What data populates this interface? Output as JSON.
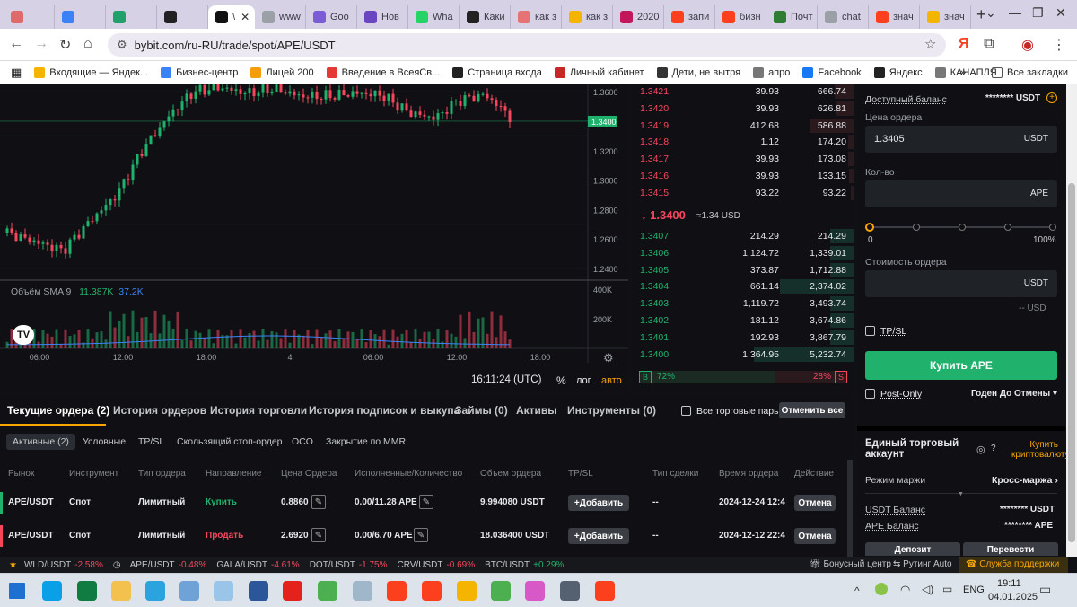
{
  "browser": {
    "tabs": [
      {
        "label": "",
        "color": "#e06a6a"
      },
      {
        "label": "",
        "color": "#3b82f6"
      },
      {
        "label": "",
        "color": "#22a06b"
      },
      {
        "label": "",
        "color": "#222222"
      },
      {
        "label": "\\",
        "color": "#111111",
        "active": true
      },
      {
        "label": "www",
        "color": "#9aa0a6"
      },
      {
        "label": "Goo",
        "color": "#7c5cd6"
      },
      {
        "label": "Нов",
        "color": "#6b46c1"
      },
      {
        "label": "Wha",
        "color": "#25d366"
      },
      {
        "label": "Каки",
        "color": "#222222"
      },
      {
        "label": "как з",
        "color": "#e57373"
      },
      {
        "label": "как з",
        "color": "#f4b400"
      },
      {
        "label": "2020",
        "color": "#c2185b"
      },
      {
        "label": "запи",
        "color": "#fc3f1d"
      },
      {
        "label": "бизн",
        "color": "#fc3f1d"
      },
      {
        "label": "Почт",
        "color": "#2e7d32"
      },
      {
        "label": "chat",
        "color": "#9aa0a6"
      },
      {
        "label": "знач",
        "color": "#fc3f1d"
      },
      {
        "label": "знач",
        "color": "#f4b400"
      }
    ],
    "url": "bybit.com/ru-RU/trade/spot/APE/USDT",
    "bookmarks": [
      {
        "label": "Входящие — Яндек...",
        "color": "#f4b400"
      },
      {
        "label": "Бизнес-центр",
        "color": "#3b82f6"
      },
      {
        "label": "Лицей 200",
        "color": "#f59e0b"
      },
      {
        "label": "Введение в ВсеяСв...",
        "color": "#e53935"
      },
      {
        "label": "Страница входа",
        "color": "#222222"
      },
      {
        "label": "Личный кабинет",
        "color": "#c62828"
      },
      {
        "label": "Дети, не вытря",
        "color": "#333333"
      },
      {
        "label": "апро",
        "color": "#777777"
      },
      {
        "label": "Facebook",
        "color": "#1877f2"
      },
      {
        "label": "Яндекс",
        "color": "#222222"
      },
      {
        "label": "КАНАПЛЯ",
        "color": "#777777"
      }
    ],
    "all_bookmarks": "Все закладки"
  },
  "chart": {
    "price_ticks": [
      "1.3600",
      "1.3400",
      "1.3200",
      "1.3000",
      "1.2800",
      "1.2600",
      "1.2400"
    ],
    "current_price": "1.3400",
    "volume_label": "Объём SMA 9",
    "volume_value1": "11.387K",
    "volume_value2": "37.2K",
    "vol_ticks": [
      "400K",
      "200K"
    ],
    "time_ticks": [
      "06:00",
      "12:00",
      "18:00",
      "4",
      "06:00",
      "12:00",
      "18:00"
    ],
    "clock": "16:11:24 (UTC)",
    "percent": "%",
    "log": "лог",
    "auto": "авто"
  },
  "orderbook": {
    "asks": [
      {
        "price": "1.3421",
        "qty": "39.93",
        "total": "666.74",
        "depth": 0.2
      },
      {
        "price": "1.3420",
        "qty": "39.93",
        "total": "626.81",
        "depth": 0.18
      },
      {
        "price": "1.3419",
        "qty": "412.68",
        "total": "586.88",
        "depth": 0.45
      },
      {
        "price": "1.3418",
        "qty": "1.12",
        "total": "174.20",
        "depth": 0.06
      },
      {
        "price": "1.3417",
        "qty": "39.93",
        "total": "173.08",
        "depth": 0.06
      },
      {
        "price": "1.3416",
        "qty": "39.93",
        "total": "133.15",
        "depth": 0.05
      },
      {
        "price": "1.3415",
        "qty": "93.22",
        "total": "93.22",
        "depth": 0.04
      }
    ],
    "last_price": "1.3400",
    "last_usd": "≈1.34 USD",
    "bids": [
      {
        "price": "1.3407",
        "qty": "214.29",
        "total": "214.29",
        "depth": 0.24
      },
      {
        "price": "1.3406",
        "qty": "1,124.72",
        "total": "1,339.01",
        "depth": 0.24
      },
      {
        "price": "1.3405",
        "qty": "373.87",
        "total": "1,712.88",
        "depth": 0.24
      },
      {
        "price": "1.3404",
        "qty": "661.14",
        "total": "2,374.02",
        "depth": 0.74
      },
      {
        "price": "1.3403",
        "qty": "1,119.72",
        "total": "3,493.74",
        "depth": 0.24
      },
      {
        "price": "1.3402",
        "qty": "181.12",
        "total": "3,674.86",
        "depth": 0.24
      },
      {
        "price": "1.3401",
        "qty": "192.93",
        "total": "3,867.79",
        "depth": 0.24
      },
      {
        "price": "1.3400",
        "qty": "1,364.95",
        "total": "5,232.74",
        "depth": 1.0
      }
    ],
    "buy_pct": "72%",
    "sell_pct": "28%",
    "buy_letter": "B",
    "sell_letter": "S"
  },
  "form": {
    "available_label": "Доступный баланс",
    "available_value": "******** USDT",
    "price_label": "Цена ордера",
    "price_value": "1.3405",
    "price_unit": "USDT",
    "qty_label": "Кол-во",
    "qty_unit": "APE",
    "slider_min": "0",
    "slider_max": "100%",
    "cost_label": "Стоимость ордера",
    "cost_unit": "USDT",
    "cost_usd": "-- USD",
    "tpsl": "TP/SL",
    "buy_button": "Купить APE",
    "post_only": "Post-Only",
    "tif": "Годен До Отмены"
  },
  "account": {
    "title": "Единый торговый аккаунт",
    "buy_crypto": "Купить криптовалюту",
    "margin_label": "Режим маржи",
    "margin_value": "Кросс-маржа",
    "usdt_label": "USDT Баланс",
    "usdt_value": "******** USDT",
    "ape_label": "APE Баланс",
    "ape_value": "******** APE",
    "deposit": "Депозит",
    "transfer": "Перевести"
  },
  "orders": {
    "tabs": [
      "Текущие ордера (2)",
      "История ордеров",
      "История торговли",
      "История подписок и выкупа",
      "Займы (0)",
      "Активы",
      "Инструменты (0)"
    ],
    "all_pairs": "Все торговые пары",
    "cancel_all": "Отменить все",
    "subtabs": [
      "Активные (2)",
      "Условные",
      "TP/SL",
      "Скользящий стоп-ордер",
      "OCO",
      "Закрытие по MMR"
    ],
    "columns": [
      "Рынок",
      "Инструмент",
      "Тип ордера",
      "Направление",
      "Цена Ордера",
      "Исполненные/Количество",
      "Объем ордера",
      "TP/SL",
      "Тип сделки",
      "Время ордера",
      "Действие"
    ],
    "rows": [
      {
        "market": "APE/USDT",
        "instrument": "Спот",
        "type": "Лимитный",
        "side": "Купить",
        "price": "0.8860",
        "filled": "0.00/11.28 APE",
        "value": "9.994080 USDT",
        "add": "Добавить",
        "deal": "--",
        "time": "2024-12-24 12:4",
        "action": "Отмена",
        "side_color": "#20b26c"
      },
      {
        "market": "APE/USDT",
        "instrument": "Спот",
        "type": "Лимитный",
        "side": "Продать",
        "price": "2.6920",
        "filled": "0.00/6.70 APE",
        "value": "18.036400 USDT",
        "add": "Добавить",
        "deal": "--",
        "time": "2024-12-12 22:4",
        "action": "Отмена",
        "side_color": "#f6465d"
      }
    ]
  },
  "ticker": [
    {
      "pair": "WLD/USDT",
      "change": "-2.58%"
    },
    {
      "pair": "APE/USDT",
      "change": "-0.48%"
    },
    {
      "pair": "GALA/USDT",
      "change": "-4.61%"
    },
    {
      "pair": "DOT/USDT",
      "change": "-1.75%"
    },
    {
      "pair": "CRV/USDT",
      "change": "-0.69%"
    },
    {
      "pair": "BTC/USDT",
      "change": "+0.29%"
    }
  ],
  "ticker_right": {
    "bonus": "Бонусный центр",
    "routing": "Рутинг Auto",
    "support": "Служба поддержки"
  },
  "taskbar": {
    "time": "19:11",
    "date": "04.01.2025",
    "lang": "ENG"
  },
  "colors": {
    "up": "#20b26c",
    "down": "#f6465d",
    "accent": "#f7a600"
  }
}
